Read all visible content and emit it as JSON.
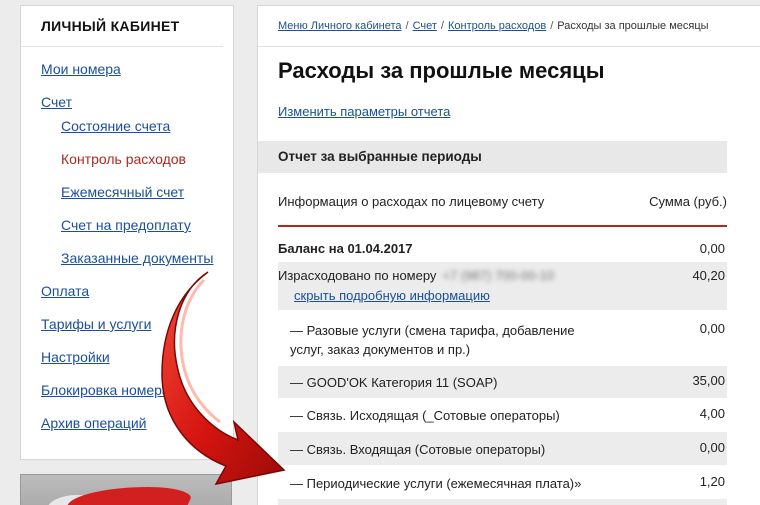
{
  "sidebar": {
    "title": "ЛИЧНЫЙ КАБИНЕТ",
    "items": [
      {
        "label": "Мои номера"
      },
      {
        "label": "Счет"
      },
      {
        "label": "Состояние счета"
      },
      {
        "label": "Контроль расходов"
      },
      {
        "label": "Ежемесячный счет"
      },
      {
        "label": "Счет на предоплату"
      },
      {
        "label": "Заказанные документы"
      },
      {
        "label": "Оплата"
      },
      {
        "label": "Тарифы и услуги"
      },
      {
        "label": "Настройки"
      },
      {
        "label": "Блокировка номера"
      },
      {
        "label": "Архив операций"
      }
    ]
  },
  "breadcrumb": {
    "items": [
      "Меню Личного кабинета",
      "Счет",
      "Контроль расходов"
    ],
    "current": "Расходы за прошлые месяцы",
    "separator": "/"
  },
  "page": {
    "title": "Расходы за прошлые месяцы",
    "report_link": "Изменить параметры отчета",
    "section_title": "Отчет за выбранные периоды"
  },
  "table": {
    "columns": [
      "Информация о расходах по лицевому счету",
      "Сумма (руб.)"
    ],
    "balance": {
      "label": "Баланс на 01.04.2017",
      "amount": "0,00"
    },
    "spent": {
      "label": "Израсходовано по номеру",
      "number_blurred": "+7 (987) 700-00-10",
      "amount": "40,20",
      "hide_link": "скрыть подробную информацию"
    },
    "rows": [
      {
        "label": "— Разовые услуги (смена тарифа, добавление услуг, заказ документов и пр.)",
        "amount": "0,00"
      },
      {
        "label": "— GOOD'OK Категория 11 (SOAP)",
        "amount": "35,00"
      },
      {
        "label": "— Связь. Исходящая (_Сотовые операторы)",
        "amount": "4,00"
      },
      {
        "label": "— Связь. Входящая (Сотовые операторы)",
        "amount": "0,00"
      },
      {
        "label": "— Периодические услуги (ежемесячная плата)»",
        "amount": "1,20"
      }
    ]
  },
  "colors": {
    "accent_red": "#b0281f",
    "link_blue": "#1a4f9c",
    "shade_gray": "#ececec"
  }
}
